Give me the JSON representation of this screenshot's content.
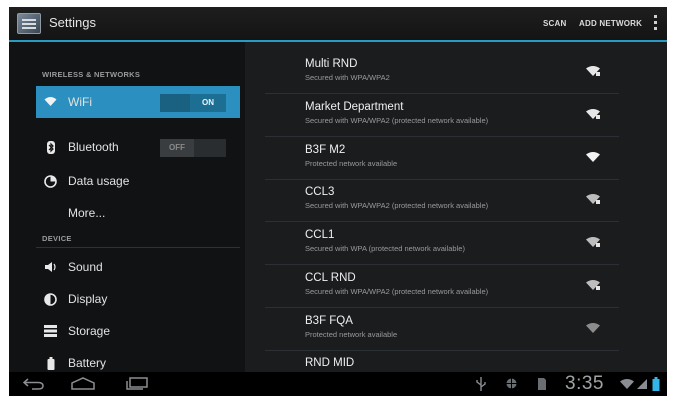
{
  "action_bar": {
    "title": "Settings",
    "scan_label": "SCAN",
    "add_network_label": "ADD NETWORK"
  },
  "sidebar": {
    "section_wireless": "WIRELESS & NETWORKS",
    "section_device": "DEVICE",
    "items": [
      {
        "label": "WiFi",
        "icon": "wifi-icon",
        "toggle": "ON",
        "selected": true
      },
      {
        "label": "Bluetooth",
        "icon": "bluetooth-icon",
        "toggle": "OFF"
      },
      {
        "label": "Data usage",
        "icon": "data-usage-icon"
      },
      {
        "label": "More..."
      },
      {
        "label": "Sound",
        "icon": "sound-icon"
      },
      {
        "label": "Display",
        "icon": "display-icon"
      },
      {
        "label": "Storage",
        "icon": "storage-icon"
      },
      {
        "label": "Battery",
        "icon": "battery-icon"
      }
    ]
  },
  "networks": [
    {
      "name": "Multi RND",
      "status": "Secured with WPA/WPA2",
      "secured": true
    },
    {
      "name": "Market Department",
      "status": "Secured with WPA/WPA2 (protected network available)",
      "secured": true
    },
    {
      "name": "B3F M2",
      "status": "Protected network available",
      "secured": false
    },
    {
      "name": "CCL3",
      "status": "Secured with WPA/WPA2 (protected network available)",
      "secured": true
    },
    {
      "name": "CCL1",
      "status": "Secured with WPA (protected network available)",
      "secured": true
    },
    {
      "name": "CCL RND",
      "status": "Secured with WPA/WPA2 (protected network available)",
      "secured": true
    },
    {
      "name": "B3F FQA",
      "status": "Protected network available",
      "secured": false
    },
    {
      "name": "RND MID",
      "status": "",
      "secured": false
    }
  ],
  "status_bar": {
    "clock": "3:35"
  },
  "colors": {
    "accent": "#33b5e5",
    "selected_item": "#2b8fbf",
    "background": "#000000"
  }
}
